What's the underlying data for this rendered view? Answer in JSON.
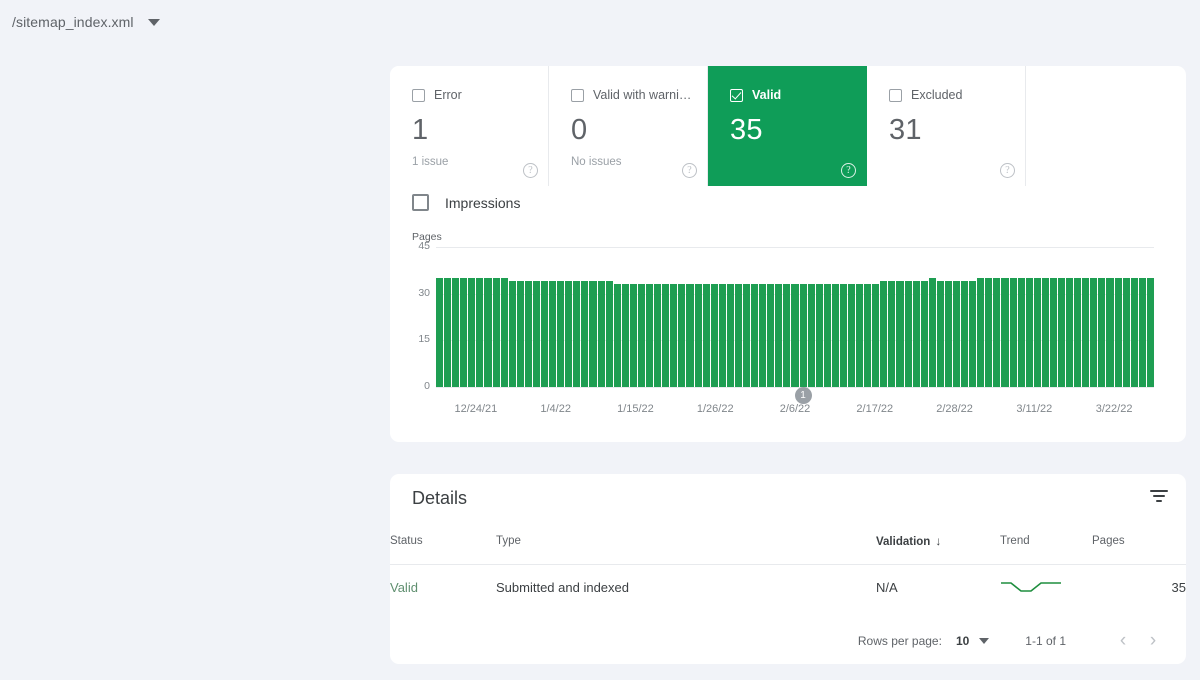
{
  "sitemap": {
    "name": "/sitemap_index.xml",
    "dropdown_icon": "chevron-down-icon"
  },
  "status_cards": [
    {
      "label": "Error",
      "value": "1",
      "sub": "1 issue",
      "selected": false,
      "help_icon": "help-icon"
    },
    {
      "label": "Valid with warnin…",
      "value": "0",
      "sub": "No issues",
      "selected": false,
      "help_icon": "help-icon"
    },
    {
      "label": "Valid",
      "value": "35",
      "sub": "",
      "selected": true,
      "help_icon": "help-icon"
    },
    {
      "label": "Excluded",
      "value": "31",
      "sub": "",
      "selected": false,
      "help_icon": "help-icon"
    }
  ],
  "impressions": {
    "label": "Impressions",
    "checked": false
  },
  "colors": {
    "valid_green": "#0f9d58",
    "bar_green": "#1e9e52",
    "sparkline_green": "#1e8e3e",
    "background": "#f1f3f8",
    "text_primary": "#3c4043",
    "text_secondary": "#5f6368"
  },
  "chart_data": {
    "type": "bar",
    "title": "",
    "ylabel": "Pages",
    "xlabel": "",
    "ylim": [
      0,
      45
    ],
    "yticks": [
      0,
      15,
      30,
      45
    ],
    "grid": true,
    "legend": "none",
    "annotations": [
      {
        "label": "1",
        "x_index": 45,
        "type": "issue-marker"
      }
    ],
    "x_tick_labels": [
      "12/24/21",
      "1/4/22",
      "1/15/22",
      "1/26/22",
      "2/6/22",
      "2/17/22",
      "2/28/22",
      "3/11/22",
      "3/22/22"
    ],
    "categories": [
      "12/24/21",
      "12/25/21",
      "12/26/21",
      "12/27/21",
      "12/28/21",
      "12/29/21",
      "12/30/21",
      "12/31/21",
      "1/1/22",
      "1/2/22",
      "1/3/22",
      "1/4/22",
      "1/5/22",
      "1/6/22",
      "1/7/22",
      "1/8/22",
      "1/9/22",
      "1/10/22",
      "1/11/22",
      "1/12/22",
      "1/13/22",
      "1/14/22",
      "1/15/22",
      "1/16/22",
      "1/17/22",
      "1/18/22",
      "1/19/22",
      "1/20/22",
      "1/21/22",
      "1/22/22",
      "1/23/22",
      "1/24/22",
      "1/25/22",
      "1/26/22",
      "1/27/22",
      "1/28/22",
      "1/29/22",
      "1/30/22",
      "1/31/22",
      "2/1/22",
      "2/2/22",
      "2/3/22",
      "2/4/22",
      "2/5/22",
      "2/6/22",
      "2/7/22",
      "2/8/22",
      "2/9/22",
      "2/10/22",
      "2/11/22",
      "2/12/22",
      "2/13/22",
      "2/14/22",
      "2/15/22",
      "2/16/22",
      "2/17/22",
      "2/18/22",
      "2/19/22",
      "2/20/22",
      "2/21/22",
      "2/22/22",
      "2/23/22",
      "2/24/22",
      "2/25/22",
      "2/26/22",
      "2/27/22",
      "2/28/22",
      "3/1/22",
      "3/2/22",
      "3/3/22",
      "3/4/22",
      "3/5/22",
      "3/6/22",
      "3/7/22",
      "3/8/22",
      "3/9/22",
      "3/10/22",
      "3/11/22",
      "3/12/22",
      "3/13/22",
      "3/14/22",
      "3/15/22",
      "3/16/22",
      "3/17/22",
      "3/18/22",
      "3/19/22",
      "3/20/22",
      "3/21/22",
      "3/22/22"
    ],
    "series": [
      {
        "name": "Valid",
        "color": "#1e9e52",
        "values": [
          35,
          35,
          35,
          35,
          35,
          35,
          35,
          35,
          35,
          34,
          34,
          34,
          34,
          34,
          34,
          34,
          34,
          34,
          34,
          34,
          34,
          34,
          33,
          33,
          33,
          33,
          33,
          33,
          33,
          33,
          33,
          33,
          33,
          33,
          33,
          33,
          33,
          33,
          33,
          33,
          33,
          33,
          33,
          33,
          33,
          33,
          33,
          33,
          33,
          33,
          33,
          33,
          33,
          33,
          33,
          34,
          34,
          34,
          34,
          34,
          34,
          35,
          34,
          34,
          34,
          34,
          34,
          35,
          35,
          35,
          35,
          35,
          35,
          35,
          35,
          35,
          35,
          35,
          35,
          35,
          35,
          35,
          35,
          35,
          35,
          35,
          35,
          35,
          35
        ]
      }
    ]
  },
  "details": {
    "title": "Details",
    "filter_icon": "filter-icon",
    "columns": [
      {
        "key": "status",
        "label": "Status",
        "sorted": false
      },
      {
        "key": "type",
        "label": "Type",
        "sorted": false
      },
      {
        "key": "validation",
        "label": "Validation",
        "sorted": true,
        "sort_arrow": "↓"
      },
      {
        "key": "trend",
        "label": "Trend",
        "sorted": false
      },
      {
        "key": "pages",
        "label": "Pages",
        "sorted": false
      }
    ],
    "rows": [
      {
        "status": "Valid",
        "type": "Submitted and indexed",
        "validation": "N/A",
        "trend": [
          35,
          35,
          34,
          34,
          35,
          35,
          35
        ],
        "pages": "35"
      }
    ],
    "pagination": {
      "rows_per_page_label": "Rows per page:",
      "rows_per_page_value": "10",
      "range": "1-1 of 1",
      "prev_icon": "‹",
      "next_icon": "›"
    }
  }
}
